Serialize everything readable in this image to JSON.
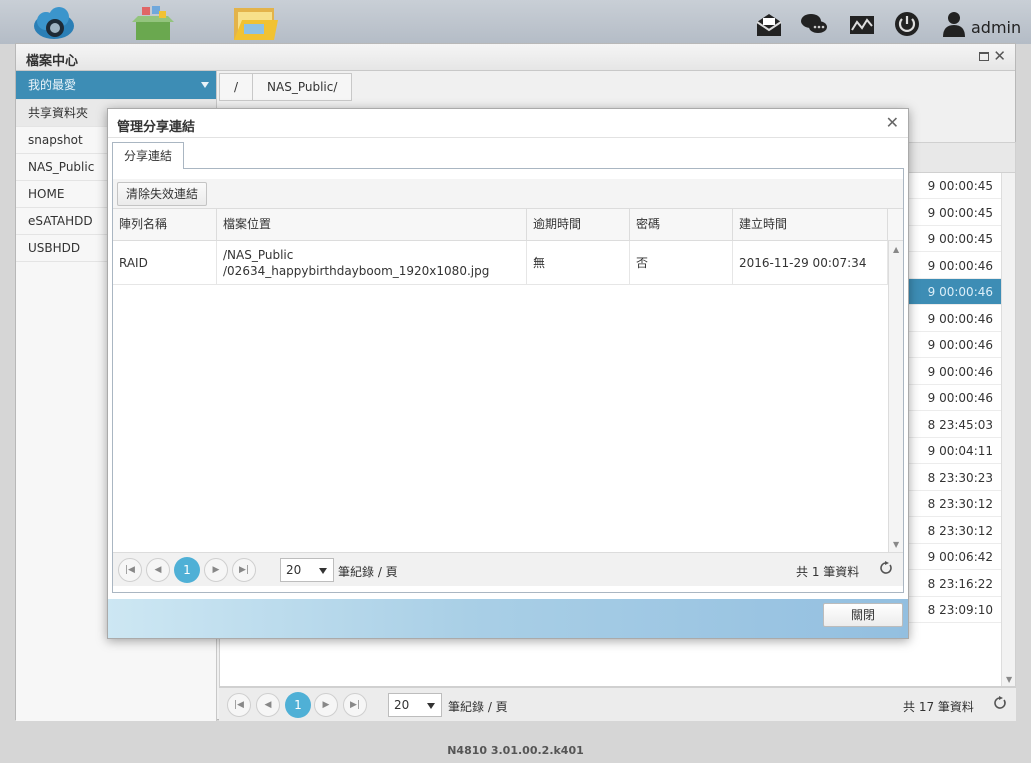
{
  "topbar": {
    "apps": [
      {
        "icon": "cloud-backup-icon"
      },
      {
        "icon": "app-center-icon"
      },
      {
        "icon": "file-center-icon"
      }
    ],
    "icons": [
      "message-icon",
      "chat-icon",
      "monitor-icon",
      "power-icon",
      "user-icon"
    ],
    "user": "admin"
  },
  "file_center": {
    "title": "檔案中心",
    "sidebar": {
      "favorites": "我的最愛",
      "shared": "共享資料夾",
      "folders": [
        "snapshot",
        "NAS_Public",
        "HOME",
        "eSATAHDD",
        "USBHDD"
      ]
    },
    "breadcrumb": [
      "/",
      "NAS_Public/"
    ],
    "times": [
      "9 00:00:45",
      "9 00:00:45",
      "9 00:00:45",
      "9 00:00:46",
      "9 00:00:46",
      "9 00:00:46",
      "9 00:00:46",
      "9 00:00:46",
      "9 00:00:46",
      "8 23:45:03",
      "9 00:04:11",
      "8 23:30:23",
      "8 23:30:12",
      "8 23:30:12",
      "9 00:06:42",
      "8 23:16:22",
      "8 23:09:10"
    ],
    "pager": {
      "current": "1",
      "page_size": "20",
      "per_page_label": "筆紀錄 / 頁",
      "total": "共 17 筆資料"
    }
  },
  "dialog": {
    "title": "管理分享連結",
    "tab": "分享連結",
    "clear_button": "清除失效連結",
    "columns": [
      "陣列名稱",
      "檔案位置",
      "逾期時間",
      "密碼",
      "建立時間"
    ],
    "rows": [
      {
        "volume": "RAID",
        "path_line1": "/NAS_Public",
        "path_line2": "/02634_happybirthdayboom_1920x1080.jpg",
        "expiry": "無",
        "password": "否",
        "created": "2016-11-29 00:07:34"
      }
    ],
    "pager": {
      "current": "1",
      "page_size": "20",
      "per_page_label": "筆紀錄 / 頁",
      "total": "共 1 筆資料"
    },
    "close_button": "關閉"
  },
  "footer": {
    "version": "N4810   3.01.00.2.k401"
  }
}
